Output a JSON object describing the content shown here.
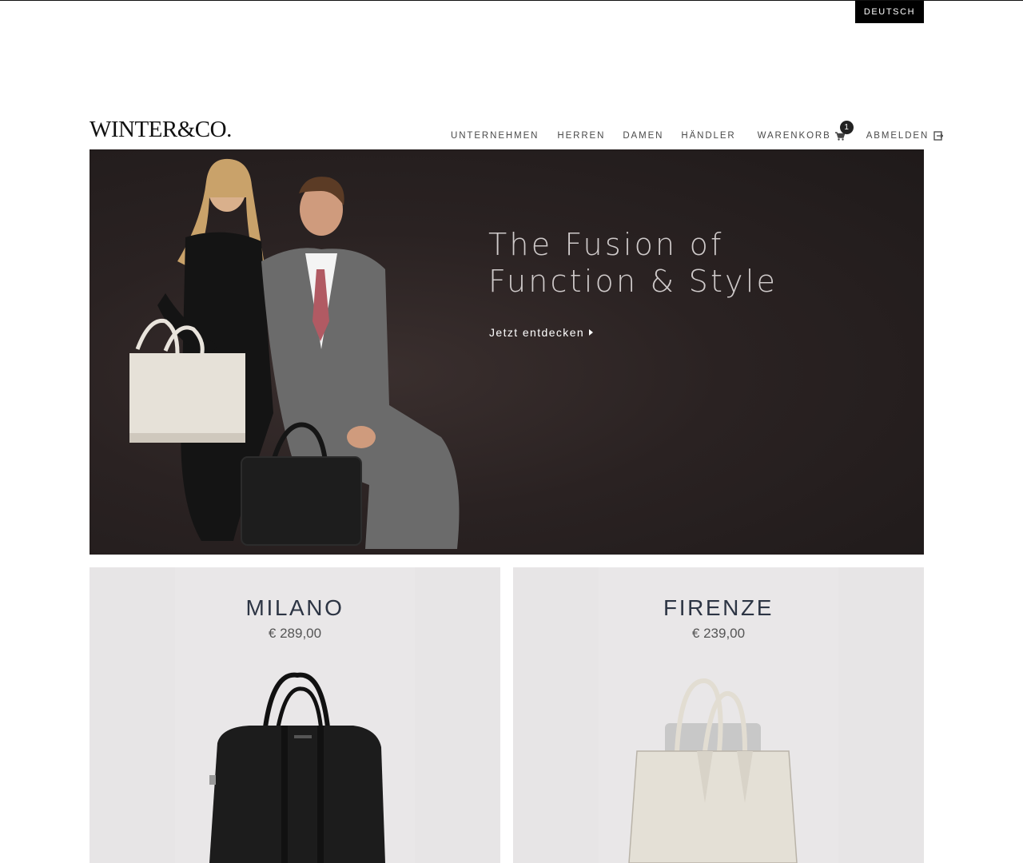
{
  "topbar": {
    "language": "DEUTSCH"
  },
  "brand": {
    "logo_text": "WINTER&CO."
  },
  "nav": {
    "items": [
      {
        "label": "UNTERNEHMEN"
      },
      {
        "label": "HERREN"
      },
      {
        "label": "DAMEN"
      },
      {
        "label": "HÄNDLER"
      },
      {
        "label": "WARENKORB"
      },
      {
        "label": "ABMELDEN"
      }
    ],
    "cart_count": "1"
  },
  "hero": {
    "title_line1": "The Fusion of",
    "title_line2": "Function & Style",
    "cta_label": "Jetzt entdecken"
  },
  "products": [
    {
      "name": "MILANO",
      "price": "€ 289,00",
      "color": "#1c1c1c"
    },
    {
      "name": "FIRENZE",
      "price": "€ 239,00",
      "color": "#e4e0d6"
    }
  ],
  "colors": {
    "hero_background": "#2a2222",
    "card_background": "#e7e5e6",
    "language_button": "#000000"
  }
}
